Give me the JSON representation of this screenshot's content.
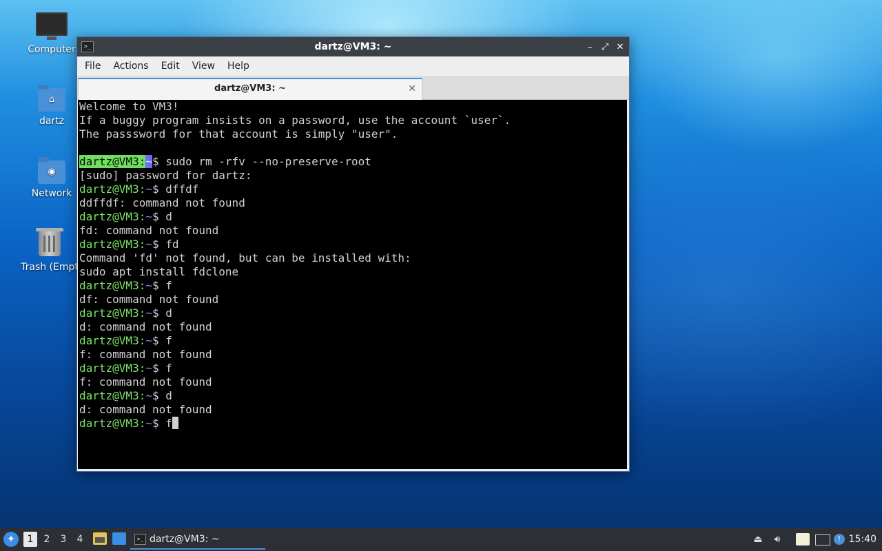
{
  "desktop": {
    "icons": [
      {
        "label": "Computer",
        "icon": "computer-icon"
      },
      {
        "label": "dartz",
        "icon": "home-folder-icon"
      },
      {
        "label": "Network",
        "icon": "network-folder-icon"
      },
      {
        "label": "Trash (Empt",
        "icon": "trash-icon"
      }
    ]
  },
  "window": {
    "title": "dartz@VM3: ~",
    "controls": {
      "minimize": "–",
      "maximize": "⤢",
      "close": "✕"
    },
    "menu": [
      "File",
      "Actions",
      "Edit",
      "View",
      "Help"
    ],
    "tab": {
      "label": "dartz@VM3: ~",
      "close": "✕"
    }
  },
  "terminal": {
    "prompt_user": "dartz@VM3:",
    "prompt_path": "~",
    "prompt_sym": "$ ",
    "lines": [
      {
        "type": "text",
        "text": "Welcome to VM3!"
      },
      {
        "type": "text",
        "text": "If a buggy program insists on a password, use the account `user`."
      },
      {
        "type": "text",
        "text": "The passsword for that account is simply \"user\"."
      },
      {
        "type": "text",
        "text": ""
      },
      {
        "type": "prompt",
        "cmd": "sudo rm -rfv --no-preserve-root",
        "highlight": true
      },
      {
        "type": "text",
        "text": "[sudo] password for dartz:"
      },
      {
        "type": "prompt",
        "cmd": "dffdf"
      },
      {
        "type": "text",
        "text": "ddffdf: command not found"
      },
      {
        "type": "prompt",
        "cmd": "d"
      },
      {
        "type": "text",
        "text": "fd: command not found"
      },
      {
        "type": "prompt",
        "cmd": "fd"
      },
      {
        "type": "text",
        "text": "Command 'fd' not found, but can be installed with:"
      },
      {
        "type": "text",
        "text": "sudo apt install fdclone"
      },
      {
        "type": "prompt",
        "cmd": "f"
      },
      {
        "type": "text",
        "text": "df: command not found"
      },
      {
        "type": "prompt",
        "cmd": "d"
      },
      {
        "type": "text",
        "text": "d: command not found"
      },
      {
        "type": "prompt",
        "cmd": "f"
      },
      {
        "type": "text",
        "text": "f: command not found"
      },
      {
        "type": "prompt",
        "cmd": "f"
      },
      {
        "type": "text",
        "text": "f: command not found"
      },
      {
        "type": "prompt",
        "cmd": "d"
      },
      {
        "type": "text",
        "text": "d: command not found"
      },
      {
        "type": "prompt",
        "cmd": "f",
        "cursor": true
      }
    ]
  },
  "taskbar": {
    "workspaces": [
      "1",
      "2",
      "3",
      "4"
    ],
    "active_workspace": "1",
    "task_label": "dartz@VM3: ~",
    "clock": "15:40"
  },
  "colors": {
    "accent": "#4a90d9",
    "prompt_user": "#7ce36a",
    "prompt_path": "#6f8ff5"
  }
}
